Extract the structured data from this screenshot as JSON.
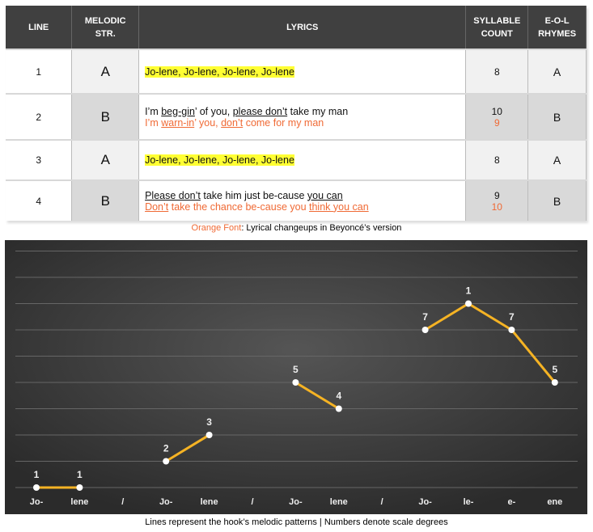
{
  "table": {
    "headers": [
      "LINE",
      "MELODIC\nSTR.",
      "LYRICS",
      "SYLLABLE\nCOUNT",
      "E-O-L\nRHYMES"
    ],
    "rows": [
      {
        "line": "1",
        "melodic": "A",
        "lyric1": [
          {
            "t": "Jo-lene, Jo-lene, Jo-lene, Jo-lene",
            "hl": true
          }
        ],
        "count1": "8",
        "rhyme": "A"
      },
      {
        "line": "2",
        "melodic": "B",
        "lyric1": [
          {
            "t": "I’m "
          },
          {
            "t": "beg-gin",
            "u": true
          },
          {
            "t": "’ of you, "
          },
          {
            "t": "please don’t",
            "u": true
          },
          {
            "t": " take my man"
          }
        ],
        "lyric2": [
          {
            "t": "I’m "
          },
          {
            "t": "warn-in",
            "u": true
          },
          {
            "t": "’ you, "
          },
          {
            "t": "don’t",
            "u": true
          },
          {
            "t": " come for my man"
          }
        ],
        "count1": "10",
        "count2": "9",
        "rhyme": "B"
      },
      {
        "line": "3",
        "melodic": "A",
        "lyric1": [
          {
            "t": "Jo-lene, Jo-lene, Jo-lene, Jo-lene",
            "hl": true
          }
        ],
        "count1": "8",
        "rhyme": "A"
      },
      {
        "line": "4",
        "melodic": "B",
        "lyric1": [
          {
            "t": "Please don’t",
            "u": true
          },
          {
            "t": " take him just be-cause "
          },
          {
            "t": "you can",
            "u": true
          }
        ],
        "lyric2": [
          {
            "t": "Don’t",
            "u": true
          },
          {
            "t": " take the chance be-cause you "
          },
          {
            "t": "think you can",
            "u": true
          }
        ],
        "count1": "9",
        "count2": "10",
        "rhyme": "B"
      }
    ],
    "legend_key": "Orange Font",
    "legend_text": ": Lyrical changeups in Beyoncé’s version"
  },
  "colors": {
    "orange_text": "#f06a35",
    "highlight": "#ffff33",
    "line": "#f5b324",
    "header": "#404040"
  },
  "chart_data": {
    "type": "line",
    "categories": [
      "Jo-",
      "lene",
      "/",
      "Jo-",
      "lene",
      "/",
      "Jo-",
      "lene",
      "/",
      "Jo-",
      "le-",
      "e-",
      "ene"
    ],
    "pitch_levels": [
      0,
      9
    ],
    "grid": true,
    "segments": [
      [
        {
          "x": 0,
          "degree": "1",
          "pitch": 0
        },
        {
          "x": 1,
          "degree": "1",
          "pitch": 0
        }
      ],
      [
        {
          "x": 3,
          "degree": "2",
          "pitch": 1
        },
        {
          "x": 4,
          "degree": "3",
          "pitch": 2
        }
      ],
      [
        {
          "x": 6,
          "degree": "5",
          "pitch": 4
        },
        {
          "x": 7,
          "degree": "4",
          "pitch": 3
        }
      ],
      [
        {
          "x": 9,
          "degree": "7",
          "pitch": 6
        },
        {
          "x": 10,
          "degree": "1",
          "pitch": 7
        },
        {
          "x": 11,
          "degree": "7",
          "pitch": 6
        },
        {
          "x": 12,
          "degree": "5",
          "pitch": 4
        }
      ]
    ],
    "caption": "Lines represent the hook’s melodic patterns | Numbers denote scale degrees"
  }
}
